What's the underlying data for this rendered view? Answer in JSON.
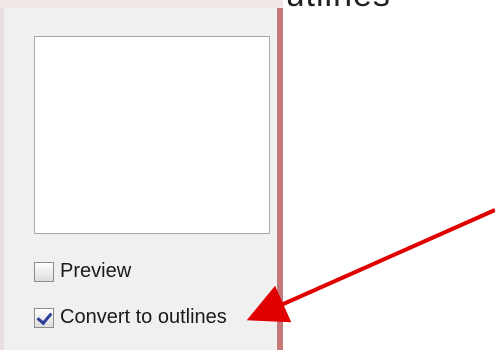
{
  "background_text": "f Convert to Outlines",
  "preview_area": {},
  "options": [
    {
      "label": "Preview",
      "checked": false
    },
    {
      "label": "Convert to outlines",
      "checked": true
    }
  ],
  "colors": {
    "dialog_bg": "#f0f0f0",
    "frame_accent": "#c3787a",
    "arrow": "#e00000",
    "check_mark": "#2b3d97"
  },
  "icons": {
    "pointer": "red-arrow-icon",
    "check": "checkmark-icon"
  }
}
